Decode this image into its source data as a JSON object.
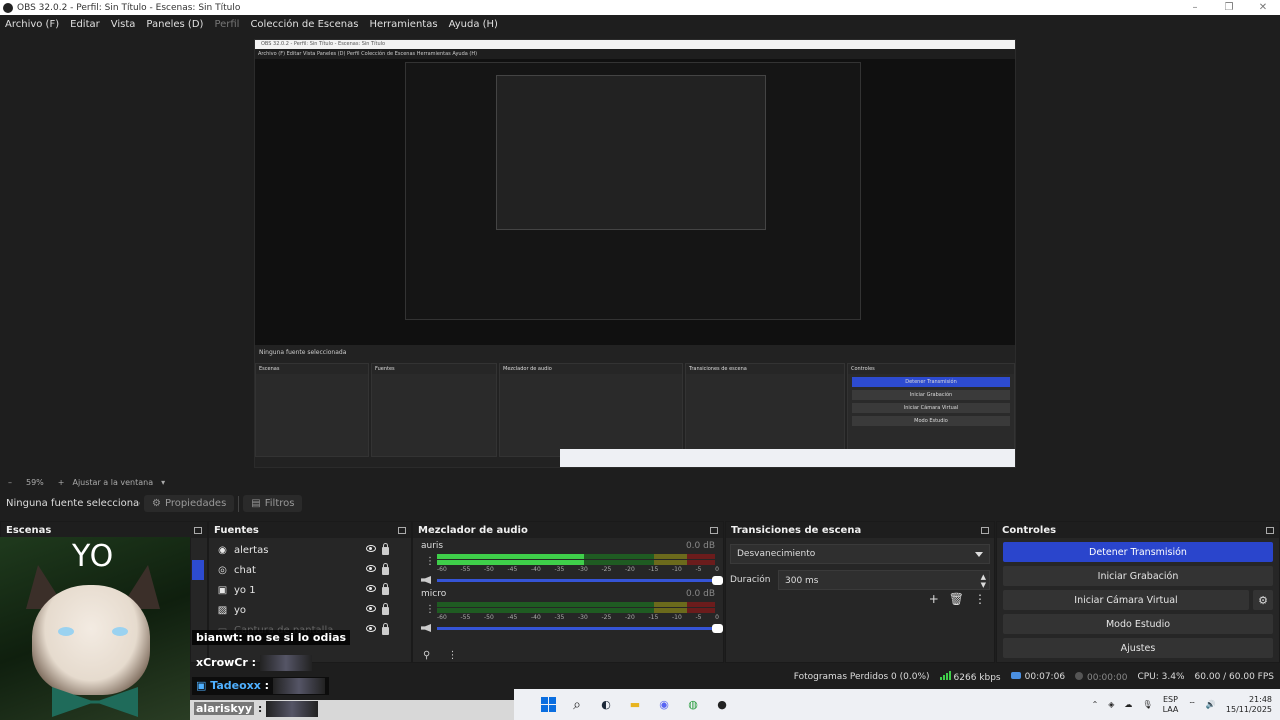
{
  "window": {
    "title": "OBS 32.0.2 - Perfil: Sin Título - Escenas: Sin Título",
    "controls": [
      "–",
      "❐",
      "✕"
    ]
  },
  "menu": {
    "archivo": "Archivo (F)",
    "editar": "Editar",
    "vista": "Vista",
    "paneles": "Paneles (D)",
    "perfil": "Perfil",
    "coleccion": "Colección de Escenas",
    "herramientas": "Herramientas",
    "ayuda": "Ayuda (H)"
  },
  "preview_nested": {
    "title": "OBS 32.0.2 - Perfil: Sin Título - Escenas: Sin Título",
    "menu": "Archivo (F)   Editar   Vista   Paneles (D)   Perfil   Colección de Escenas   Herramientas   Ayuda (H)",
    "nofuente": "Ninguna fuente seleccionada",
    "escenas": "Escenas",
    "fuentes": "Fuentes",
    "mezclador": "Mezclador de audio",
    "transiciones": "Transiciones de escena",
    "controles": "Controles",
    "detener": "Detener Transmisión",
    "grabacion": "Iniciar Grabación",
    "camara": "Iniciar Cámara Virtual",
    "estudio": "Modo Estudio",
    "ajustes": "Ajustes"
  },
  "scale": {
    "minus": "–",
    "zoom": "59%",
    "plus": "+",
    "fit": "Ajustar a la ventana",
    "caret": "▾"
  },
  "sourcebar": {
    "nofuente": "Ninguna fuente seleccionada",
    "propiedades": "Propiedades",
    "filtros": "Filtros"
  },
  "docks": {
    "escenas": "Escenas",
    "fuentes": "Fuentes",
    "mezclador": "Mezclador de audio",
    "transiciones": "Transiciones de escena",
    "controles": "Controles"
  },
  "sources": [
    {
      "name": "alertas",
      "icon": "alert-icon"
    },
    {
      "name": "chat",
      "icon": "globe-icon"
    },
    {
      "name": "yo 1",
      "icon": "camera-icon"
    },
    {
      "name": "yo",
      "icon": "image-icon"
    },
    {
      "name": "Captura de pantalla",
      "icon": "monitor-icon"
    }
  ],
  "mixer": {
    "channels": [
      {
        "name": "auris",
        "db": "0.0 dB",
        "level": 0.53
      },
      {
        "name": "micro",
        "db": "0.0 dB",
        "level": 0.0
      }
    ],
    "ticks": [
      "-60",
      "-55",
      "-50",
      "-45",
      "-40",
      "-35",
      "-30",
      "-25",
      "-20",
      "-15",
      "-10",
      "-5",
      "0"
    ]
  },
  "transitions": {
    "selected": "Desvanecimiento",
    "duration_label": "Duración",
    "duration_value": "300 ms"
  },
  "controls": {
    "detener": "Detener Transmisión",
    "grabacion": "Iniciar Grabación",
    "camara": "Iniciar Cámara Virtual",
    "estudio": "Modo Estudio",
    "ajustes": "Ajustes"
  },
  "status": {
    "frames": "Fotogramas Perdidos 0 (0.0%)",
    "kbps": "6266 kbps",
    "stream_time": "00:07:06",
    "rec_time": "00:00:00",
    "cpu": "CPU: 3.4%",
    "fps": "60.00 / 60.00 FPS"
  },
  "webcam": {
    "label": "YO"
  },
  "chat": [
    {
      "user": "bianwt",
      "msg": ": no se si lo odias"
    },
    {
      "user": "xCrowCr",
      "msg": " :"
    },
    {
      "user": "Tadeoxx",
      "msg": " :"
    },
    {
      "user": "alariskyy",
      "msg": " :"
    }
  ],
  "taskbar": {
    "lang_top": "ESP",
    "lang_bottom": "LAA",
    "time": "21:48",
    "date": "15/11/2025"
  },
  "colors": {
    "accent": "#2a45cc",
    "meter_green": "#3fcf4a",
    "bg": "#1e1e1e"
  }
}
